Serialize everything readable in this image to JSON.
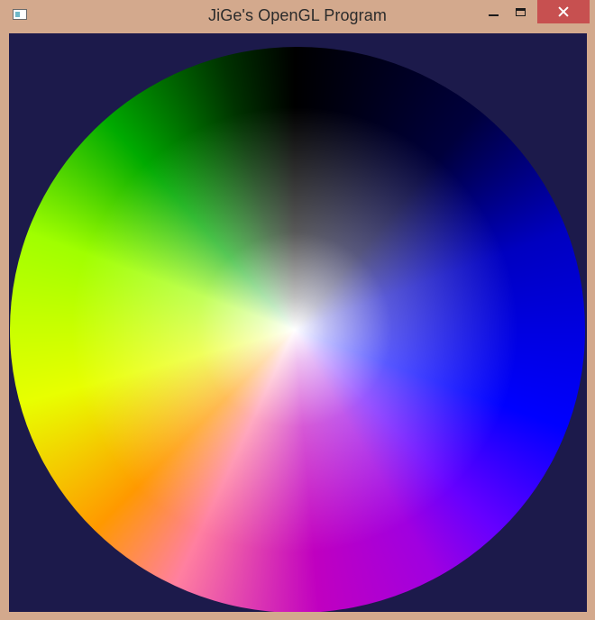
{
  "window": {
    "title": "JiGe's OpenGL Program",
    "colors": {
      "frame": "#d3a98d",
      "client_background": "#1c1a4b",
      "close_button": "#c75050"
    }
  },
  "titlebar": {
    "app_icon": "opengl-window-icon",
    "min_icon": "minimize-icon",
    "max_icon": "maximize-icon",
    "close_icon": "close-icon"
  },
  "canvas": {
    "content": "color-wheel",
    "center_color": "#ffffff",
    "hue_stops": [
      "#000000",
      "#0000ff",
      "#a000e0",
      "#ff9900",
      "#e8ff00",
      "#00aa00"
    ]
  }
}
